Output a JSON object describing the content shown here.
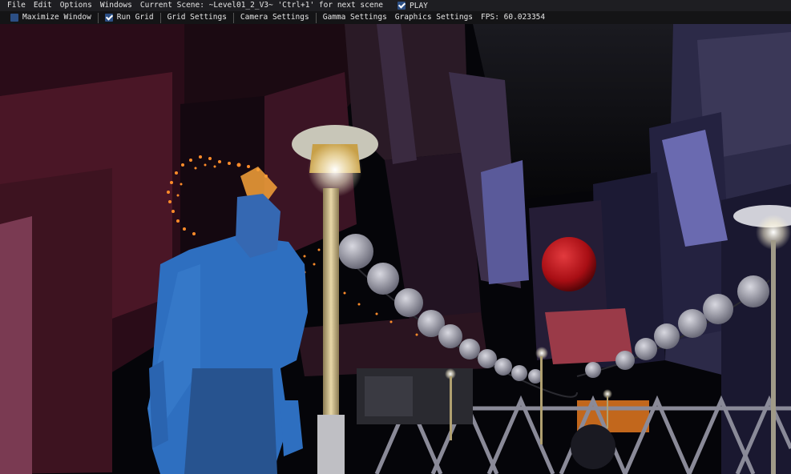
{
  "menu": {
    "items": [
      "File",
      "Edit",
      "Options",
      "Windows"
    ],
    "current_scene": "Current Scene: ~Level01_2_V3~ 'Ctrl+1' for next scene",
    "play_label": "PLAY",
    "play_checked": true
  },
  "toolbar": {
    "maximize_label": "Maximize Window",
    "maximize_checked": false,
    "run_grid_label": "Run Grid",
    "run_grid_checked": true,
    "grid_settings": "Grid Settings",
    "camera_settings": "Camera Settings",
    "gamma_settings": "Gamma Settings",
    "graphics_settings": "Graphics Settings",
    "fps": "FPS: 60.023354"
  },
  "scene": {
    "colors": {
      "sky": "#050509",
      "buildings_left": "#3a1422",
      "buildings_right": "#2c2a48",
      "player": "#2e6fc0",
      "lamp_light": "#ffffff",
      "orb": "#b81218",
      "particles": "#ff8c2a"
    }
  }
}
